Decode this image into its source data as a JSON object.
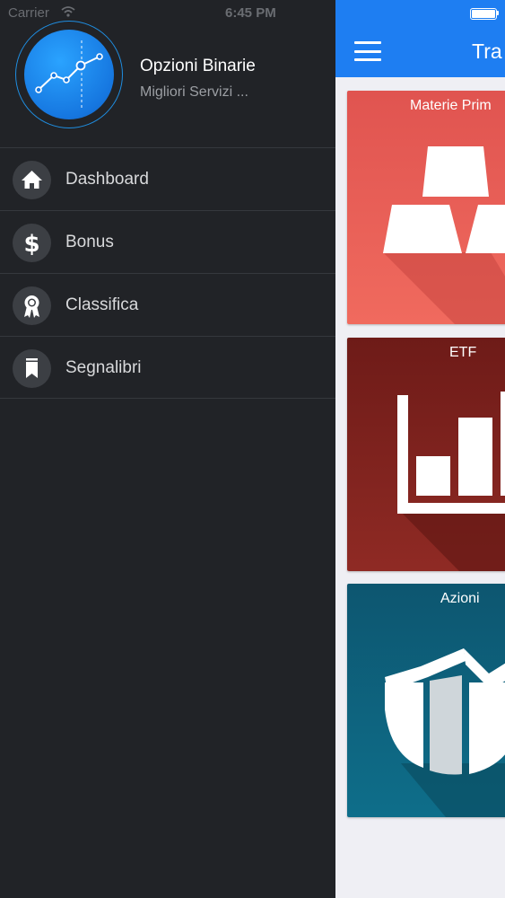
{
  "status_bar": {
    "carrier": "Carrier",
    "time": "6:45 PM"
  },
  "drawer": {
    "app_name": "Opzioni Binarie",
    "app_subtitle": "Migliori Servizi ...",
    "items": [
      {
        "label": "Dashboard",
        "icon": "home-icon"
      },
      {
        "label": "Bonus",
        "icon": "dollar-icon"
      },
      {
        "label": "Classifica",
        "icon": "award-ribbon-icon"
      },
      {
        "label": "Segnalibri",
        "icon": "bookmark-icon"
      }
    ]
  },
  "main": {
    "nav_title": "Tra",
    "cards": [
      {
        "title": "Materie Prim",
        "icon": "gold-bars-icon",
        "color": "#E85B53"
      },
      {
        "title": "ETF",
        "icon": "bar-chart-icon",
        "color": "#7F2320"
      },
      {
        "title": "Azioni",
        "icon": "pie-chart-icon",
        "color": "#0E627D"
      }
    ]
  },
  "colors": {
    "accent": "#1E7EF2",
    "drawer_bg": "#212327"
  }
}
